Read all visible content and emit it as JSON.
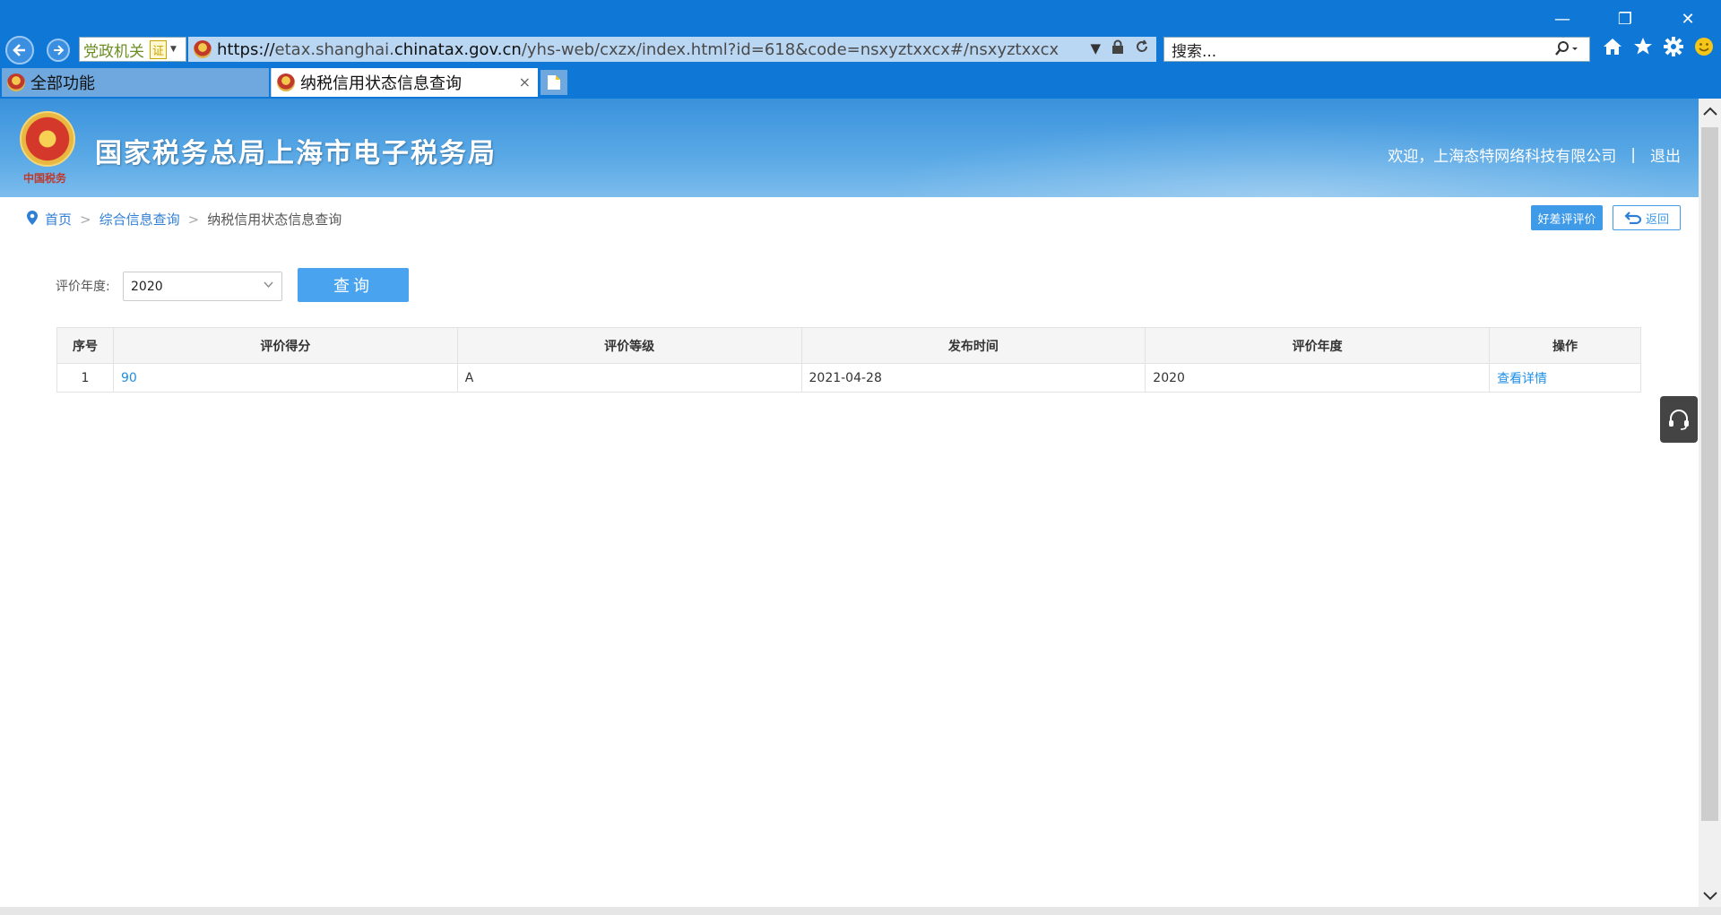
{
  "browser": {
    "window_controls": {
      "minimize": "—",
      "restore": "❐",
      "close": "✕"
    },
    "nav": {
      "back_icon": "arrow-left",
      "forward_icon": "arrow-right"
    },
    "security_tag": {
      "label": "党政机关",
      "cert": "证"
    },
    "address": {
      "scheme": "https://",
      "sub": "etax.shanghai.",
      "host": "chinatax.gov.cn",
      "path": "/yhs-web/cxzx/index.html?id=618&code=nsxyztxxcx#/nsxyztxxcx"
    },
    "search": {
      "placeholder": "搜索..."
    },
    "tabs": [
      {
        "label": "全部功能",
        "active": false
      },
      {
        "label": "纳税信用状态信息查询",
        "active": true
      }
    ],
    "tab_close": "×"
  },
  "banner": {
    "site_title": "国家税务总局上海市电子税务局",
    "emblem_sub": "中国税务",
    "welcome": "欢迎，上海态特网络科技有限公司",
    "separator": "|",
    "logout": "退出"
  },
  "breadcrumb": {
    "home": "首页",
    "section": "综合信息查询",
    "current": "纳税信用状态信息查询",
    "arrow": ">"
  },
  "actions": {
    "rating_label": "好差评评价",
    "back_label": "返回"
  },
  "filter": {
    "label": "评价年度:",
    "year_value": "2020",
    "query_label": "查询"
  },
  "table": {
    "headers": [
      "序号",
      "评价得分",
      "评价等级",
      "发布时间",
      "评价年度",
      "操作"
    ],
    "rows": [
      {
        "index": "1",
        "score": "90",
        "grade": "A",
        "published": "2021-04-28",
        "year": "2020",
        "action": "查看详情"
      }
    ]
  },
  "colors": {
    "chrome_blue": "#0f78d6",
    "link_blue": "#1e8fe6",
    "button_blue": "#4aa3ee"
  }
}
